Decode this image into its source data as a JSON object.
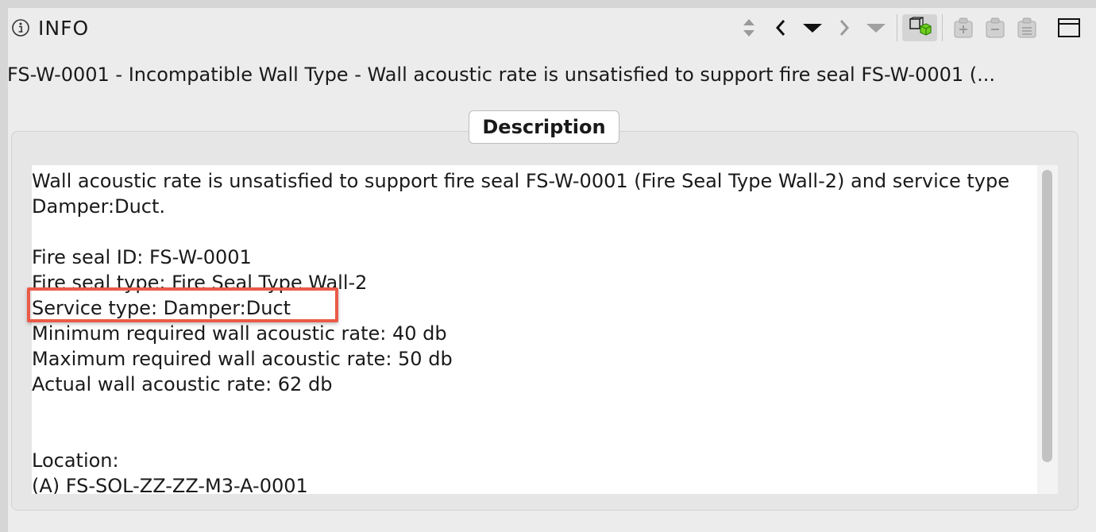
{
  "header": {
    "title": "INFO",
    "icons": {
      "info": "info-icon",
      "sort": "sort-updown-icon",
      "prev": "chevron-left-icon",
      "dropdown1": "triangle-down-icon",
      "next": "chevron-right-icon",
      "dropdown2": "triangle-down-icon",
      "model_view": "3d-model-icon",
      "add": "add-issue-icon",
      "remove": "remove-issue-icon",
      "list": "list-issue-icon",
      "window": "window-icon"
    }
  },
  "issue": {
    "title": "FS-W-0001 - Incompatible Wall Type - Wall acoustic rate is unsatisfied to support fire seal FS-W-0001 (..."
  },
  "description": {
    "group_label": "Description",
    "summary": "Wall acoustic rate is unsatisfied to support fire seal FS-W-0001 (Fire Seal Type Wall-2) and service type Damper:Duct.",
    "fields": [
      "Fire seal ID: FS-W-0001",
      "Fire seal type: Fire Seal Type Wall-2",
      "Service type: Damper:Duct",
      "Minimum required wall acoustic rate: 40 db",
      "Maximum required wall acoustic rate: 50 db",
      "Actual wall acoustic rate: 62 db"
    ],
    "location_label": "Location:",
    "location_value": "(A) FS-SOL-ZZ-ZZ-M3-A-0001"
  },
  "colors": {
    "highlight": "#ea5a47",
    "model_icon_accent": "#6ed01e"
  }
}
